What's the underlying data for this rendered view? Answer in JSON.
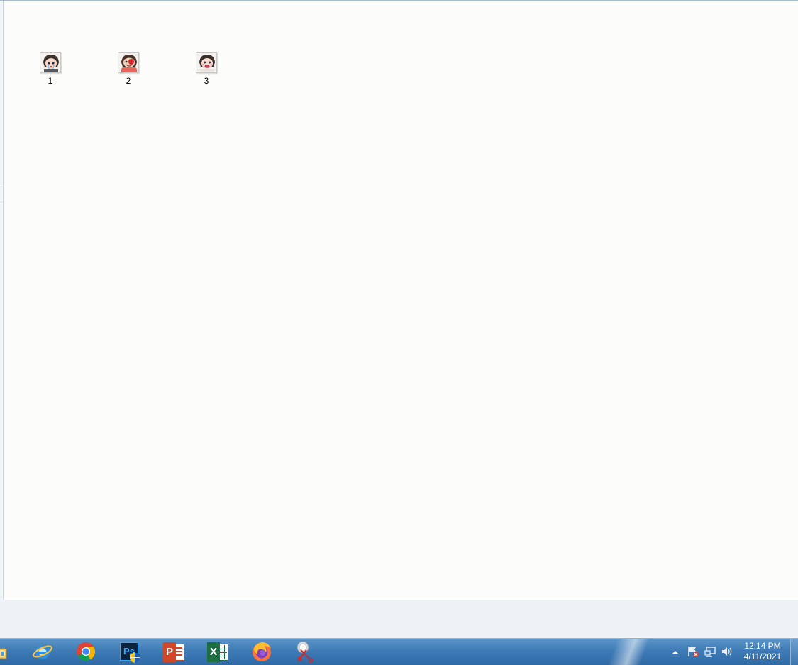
{
  "files": [
    {
      "name": "1",
      "icon": "avatar-thumbnail-icon"
    },
    {
      "name": "2",
      "icon": "avatar-thumbnail-icon"
    },
    {
      "name": "3",
      "icon": "avatar-thumbnail-icon"
    }
  ],
  "taskbar": {
    "pinned": [
      {
        "name": "explorer",
        "icon": "folder-icon"
      },
      {
        "name": "internet-explorer",
        "icon": "internet-explorer-icon"
      },
      {
        "name": "chrome",
        "icon": "chrome-icon"
      },
      {
        "name": "photoshop",
        "icon": "photoshop-icon",
        "label": "Ps"
      },
      {
        "name": "powerpoint",
        "icon": "powerpoint-icon",
        "label": "P"
      },
      {
        "name": "excel",
        "icon": "excel-icon",
        "label": "X"
      },
      {
        "name": "firefox",
        "icon": "firefox-icon"
      },
      {
        "name": "snipping-tool",
        "icon": "snipping-tool-icon"
      }
    ],
    "clock": {
      "time": "12:14 PM",
      "date": "4/11/2021"
    }
  },
  "colors": {
    "taskbar": "#3e7bb6",
    "content_bg": "#fcfdfb",
    "details_bg": "#eef2f6"
  }
}
